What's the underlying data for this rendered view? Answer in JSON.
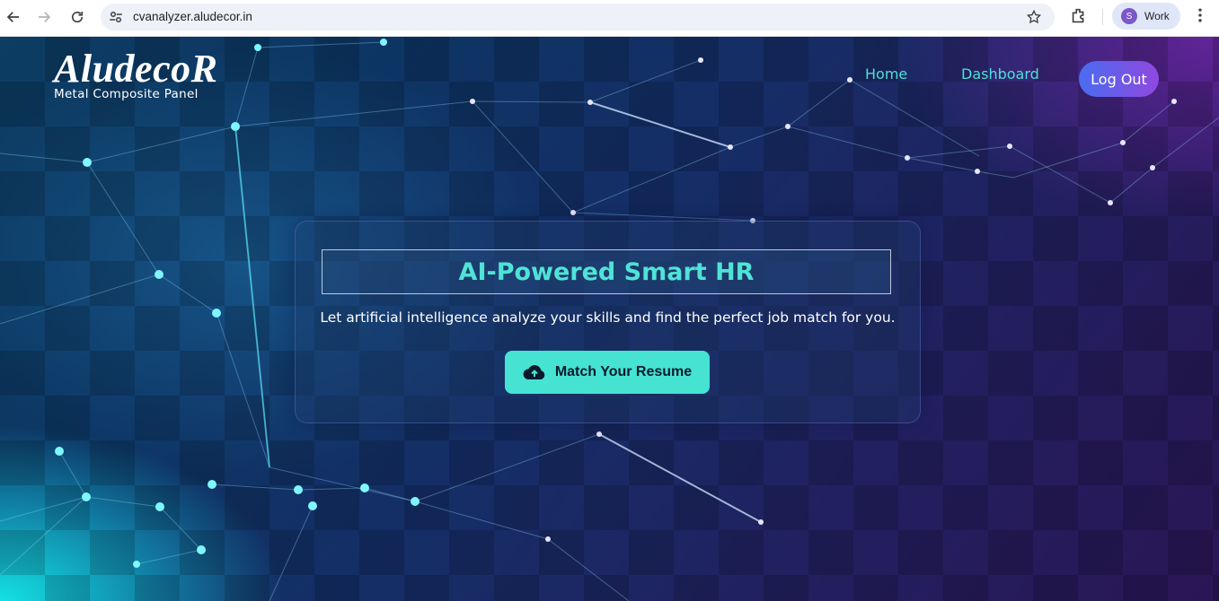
{
  "browser": {
    "url": "cvanalyzer.aludecor.in",
    "profile_initial": "S",
    "profile_name": "Work",
    "icons": [
      "back-arrow-icon",
      "forward-arrow-icon",
      "reload-icon",
      "site-info-icon",
      "bookmark-star-icon",
      "extensions-icon",
      "more-menu-icon"
    ]
  },
  "header": {
    "logo_main": "AludecoR",
    "logo_sub": "Metal Composite Panel",
    "nav": [
      {
        "label": "Home"
      },
      {
        "label": "Dashboard"
      }
    ],
    "logout_label": "Log Out"
  },
  "hero": {
    "title": "AI-Powered Smart HR",
    "subtitle": "Let artificial intelligence analyze your skills and find the perfect job match for you.",
    "button_label": "Match Your Resume",
    "button_icon": "cloud-upload-icon"
  },
  "colors": {
    "accent": "#46e3d3",
    "nav_link": "#4fe0d6",
    "logout_gradient_start": "#4a6cf0",
    "logout_gradient_end": "#9048e0"
  }
}
